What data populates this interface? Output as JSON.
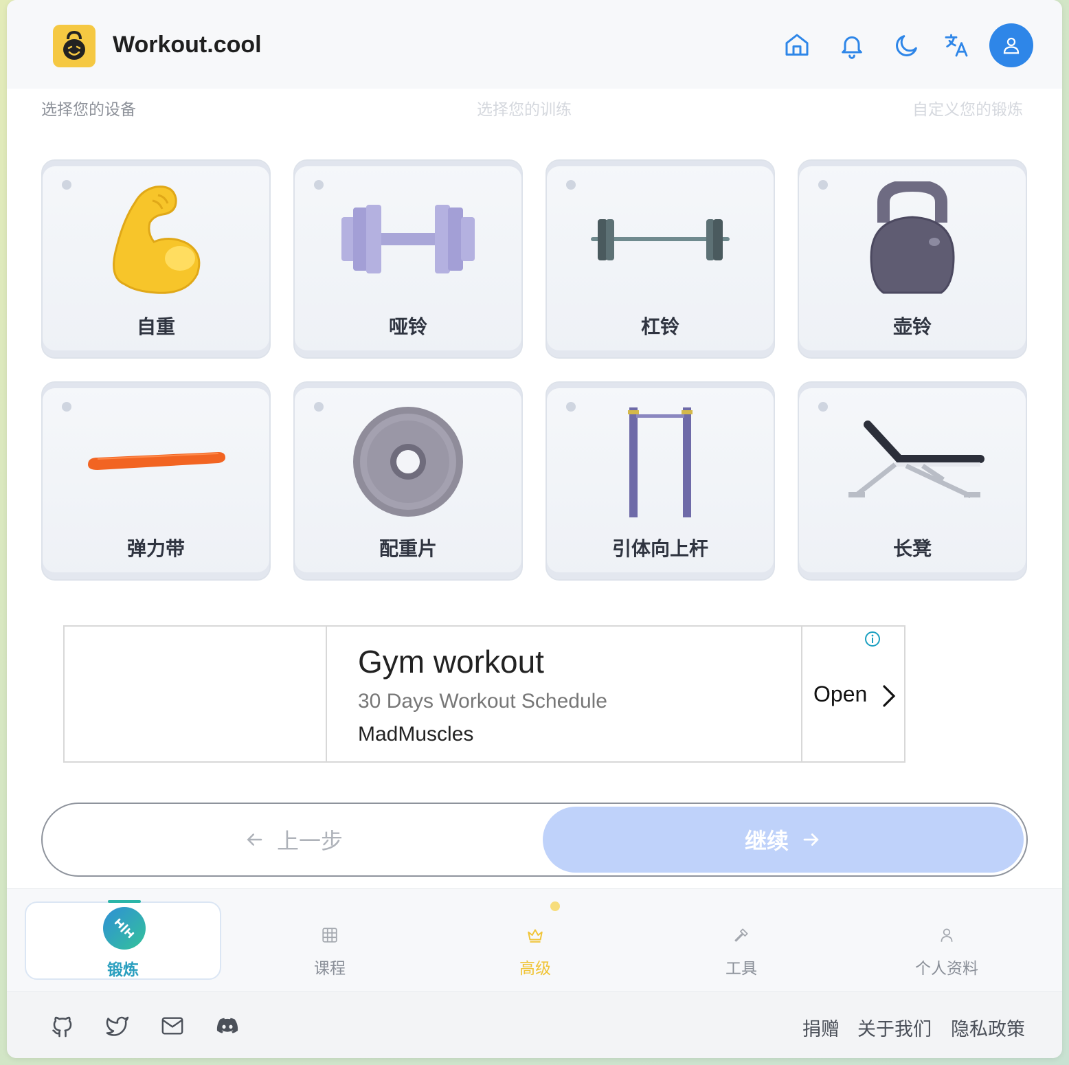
{
  "header": {
    "brand": "Workout.cool",
    "icons": [
      "home-icon",
      "bell-icon",
      "moon-icon",
      "translate-icon",
      "user-icon"
    ]
  },
  "steps": [
    {
      "label": "选择您的设备",
      "state": "active"
    },
    {
      "label": "选择您的训练",
      "state": "inactive"
    },
    {
      "label": "自定义您的锻炼",
      "state": "inactive"
    }
  ],
  "equipment": [
    {
      "label": "自重",
      "icon": "flexed-biceps-icon"
    },
    {
      "label": "哑铃",
      "icon": "dumbbell-icon"
    },
    {
      "label": "杠铃",
      "icon": "barbell-icon"
    },
    {
      "label": "壶铃",
      "icon": "kettlebell-icon"
    },
    {
      "label": "弹力带",
      "icon": "resistance-band-icon"
    },
    {
      "label": "配重片",
      "icon": "weight-plate-icon"
    },
    {
      "label": "引体向上杆",
      "icon": "pull-up-bar-icon"
    },
    {
      "label": "长凳",
      "icon": "bench-icon"
    }
  ],
  "ad": {
    "title": "Gym workout",
    "subtitle": "30 Days Workout Schedule",
    "advertiser": "MadMuscles",
    "cta": "Open"
  },
  "nav": {
    "prev_label": "上一步",
    "next_label": "继续"
  },
  "tabs": [
    {
      "label": "锻炼",
      "icon": "workout-icon",
      "active": true
    },
    {
      "label": "课程",
      "icon": "grid-icon",
      "active": false
    },
    {
      "label": "高级",
      "icon": "crown-icon",
      "active": false
    },
    {
      "label": "工具",
      "icon": "hammer-icon",
      "active": false
    },
    {
      "label": "个人资料",
      "icon": "profile-icon",
      "active": false
    }
  ],
  "footer": {
    "icons": [
      "github-icon",
      "twitter-icon",
      "mail-icon",
      "discord-icon"
    ],
    "links": [
      "捐赠",
      "关于我们",
      "隐私政策"
    ]
  },
  "colors": {
    "accent": "#2e86e8",
    "continue_bg": "#bfd2fa",
    "premium": "#f0c437",
    "workout_tab": "#2a9fbf"
  }
}
